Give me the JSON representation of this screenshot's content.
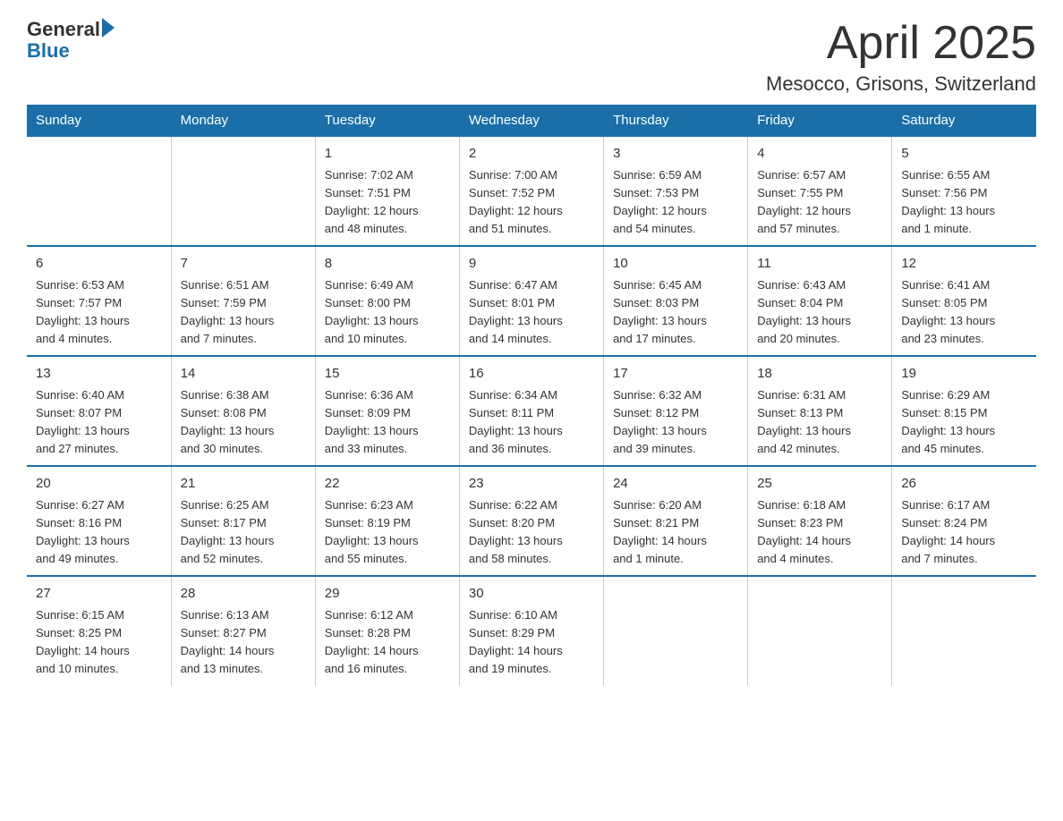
{
  "header": {
    "logo_general": "General",
    "logo_blue": "Blue",
    "title": "April 2025",
    "location": "Mesocco, Grisons, Switzerland"
  },
  "days_of_week": [
    "Sunday",
    "Monday",
    "Tuesday",
    "Wednesday",
    "Thursday",
    "Friday",
    "Saturday"
  ],
  "weeks": [
    [
      {
        "day": "",
        "info": ""
      },
      {
        "day": "",
        "info": ""
      },
      {
        "day": "1",
        "info": "Sunrise: 7:02 AM\nSunset: 7:51 PM\nDaylight: 12 hours\nand 48 minutes."
      },
      {
        "day": "2",
        "info": "Sunrise: 7:00 AM\nSunset: 7:52 PM\nDaylight: 12 hours\nand 51 minutes."
      },
      {
        "day": "3",
        "info": "Sunrise: 6:59 AM\nSunset: 7:53 PM\nDaylight: 12 hours\nand 54 minutes."
      },
      {
        "day": "4",
        "info": "Sunrise: 6:57 AM\nSunset: 7:55 PM\nDaylight: 12 hours\nand 57 minutes."
      },
      {
        "day": "5",
        "info": "Sunrise: 6:55 AM\nSunset: 7:56 PM\nDaylight: 13 hours\nand 1 minute."
      }
    ],
    [
      {
        "day": "6",
        "info": "Sunrise: 6:53 AM\nSunset: 7:57 PM\nDaylight: 13 hours\nand 4 minutes."
      },
      {
        "day": "7",
        "info": "Sunrise: 6:51 AM\nSunset: 7:59 PM\nDaylight: 13 hours\nand 7 minutes."
      },
      {
        "day": "8",
        "info": "Sunrise: 6:49 AM\nSunset: 8:00 PM\nDaylight: 13 hours\nand 10 minutes."
      },
      {
        "day": "9",
        "info": "Sunrise: 6:47 AM\nSunset: 8:01 PM\nDaylight: 13 hours\nand 14 minutes."
      },
      {
        "day": "10",
        "info": "Sunrise: 6:45 AM\nSunset: 8:03 PM\nDaylight: 13 hours\nand 17 minutes."
      },
      {
        "day": "11",
        "info": "Sunrise: 6:43 AM\nSunset: 8:04 PM\nDaylight: 13 hours\nand 20 minutes."
      },
      {
        "day": "12",
        "info": "Sunrise: 6:41 AM\nSunset: 8:05 PM\nDaylight: 13 hours\nand 23 minutes."
      }
    ],
    [
      {
        "day": "13",
        "info": "Sunrise: 6:40 AM\nSunset: 8:07 PM\nDaylight: 13 hours\nand 27 minutes."
      },
      {
        "day": "14",
        "info": "Sunrise: 6:38 AM\nSunset: 8:08 PM\nDaylight: 13 hours\nand 30 minutes."
      },
      {
        "day": "15",
        "info": "Sunrise: 6:36 AM\nSunset: 8:09 PM\nDaylight: 13 hours\nand 33 minutes."
      },
      {
        "day": "16",
        "info": "Sunrise: 6:34 AM\nSunset: 8:11 PM\nDaylight: 13 hours\nand 36 minutes."
      },
      {
        "day": "17",
        "info": "Sunrise: 6:32 AM\nSunset: 8:12 PM\nDaylight: 13 hours\nand 39 minutes."
      },
      {
        "day": "18",
        "info": "Sunrise: 6:31 AM\nSunset: 8:13 PM\nDaylight: 13 hours\nand 42 minutes."
      },
      {
        "day": "19",
        "info": "Sunrise: 6:29 AM\nSunset: 8:15 PM\nDaylight: 13 hours\nand 45 minutes."
      }
    ],
    [
      {
        "day": "20",
        "info": "Sunrise: 6:27 AM\nSunset: 8:16 PM\nDaylight: 13 hours\nand 49 minutes."
      },
      {
        "day": "21",
        "info": "Sunrise: 6:25 AM\nSunset: 8:17 PM\nDaylight: 13 hours\nand 52 minutes."
      },
      {
        "day": "22",
        "info": "Sunrise: 6:23 AM\nSunset: 8:19 PM\nDaylight: 13 hours\nand 55 minutes."
      },
      {
        "day": "23",
        "info": "Sunrise: 6:22 AM\nSunset: 8:20 PM\nDaylight: 13 hours\nand 58 minutes."
      },
      {
        "day": "24",
        "info": "Sunrise: 6:20 AM\nSunset: 8:21 PM\nDaylight: 14 hours\nand 1 minute."
      },
      {
        "day": "25",
        "info": "Sunrise: 6:18 AM\nSunset: 8:23 PM\nDaylight: 14 hours\nand 4 minutes."
      },
      {
        "day": "26",
        "info": "Sunrise: 6:17 AM\nSunset: 8:24 PM\nDaylight: 14 hours\nand 7 minutes."
      }
    ],
    [
      {
        "day": "27",
        "info": "Sunrise: 6:15 AM\nSunset: 8:25 PM\nDaylight: 14 hours\nand 10 minutes."
      },
      {
        "day": "28",
        "info": "Sunrise: 6:13 AM\nSunset: 8:27 PM\nDaylight: 14 hours\nand 13 minutes."
      },
      {
        "day": "29",
        "info": "Sunrise: 6:12 AM\nSunset: 8:28 PM\nDaylight: 14 hours\nand 16 minutes."
      },
      {
        "day": "30",
        "info": "Sunrise: 6:10 AM\nSunset: 8:29 PM\nDaylight: 14 hours\nand 19 minutes."
      },
      {
        "day": "",
        "info": ""
      },
      {
        "day": "",
        "info": ""
      },
      {
        "day": "",
        "info": ""
      }
    ]
  ]
}
